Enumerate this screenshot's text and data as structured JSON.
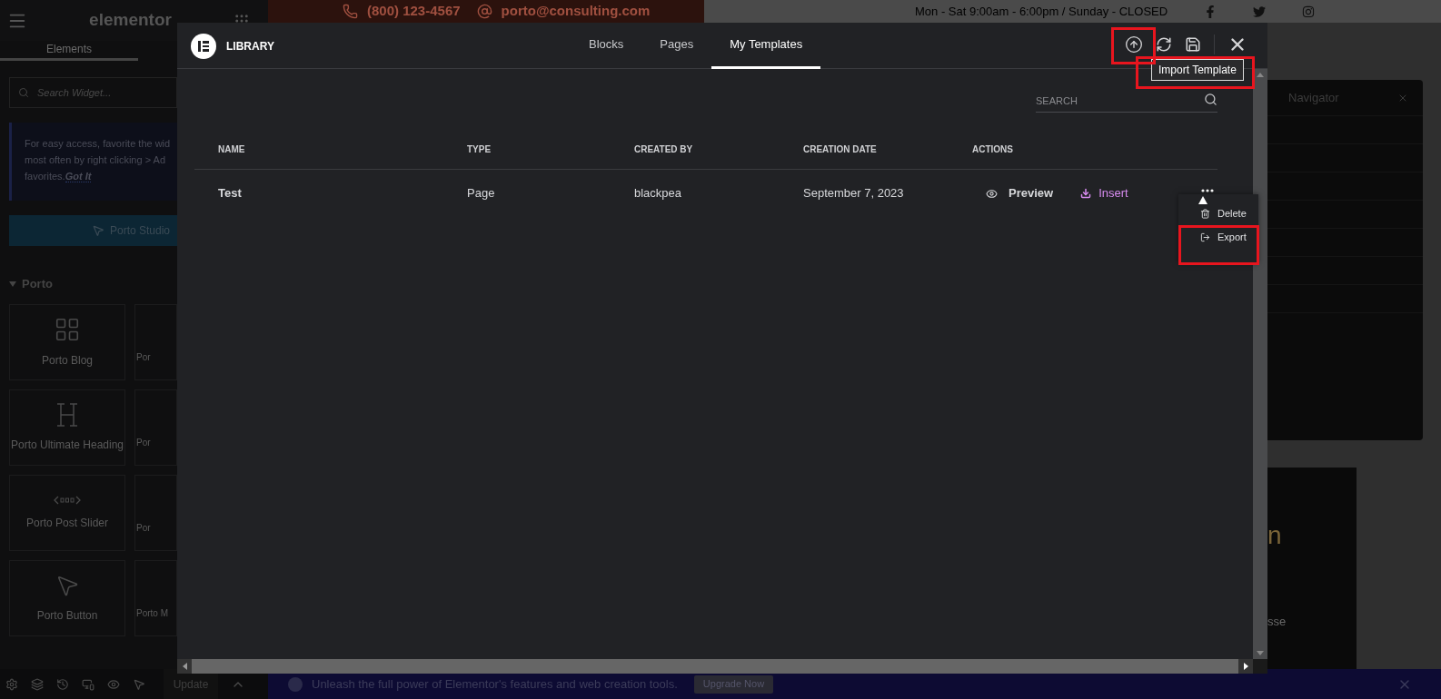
{
  "editor": {
    "brand": "elementor",
    "tabs": [
      {
        "label": "Elements",
        "selected": true
      }
    ],
    "search": {
      "placeholder": "Search Widget..."
    },
    "tip": {
      "lines": [
        "For easy access, favorite the wid",
        "most often by right clicking > Ad",
        "favorites."
      ],
      "link": "Got It"
    },
    "studio_button": "Porto Studio",
    "category": {
      "label": "Porto",
      "expanded": true
    },
    "widgets": [
      {
        "label": "Porto Blog",
        "kind": "blog"
      },
      {
        "label": "Por",
        "kind": "cut"
      },
      {
        "label": "Porto Ultimate Heading",
        "kind": "heading"
      },
      {
        "label": "Por",
        "kind": "cut"
      },
      {
        "label": "Porto Post Slider",
        "kind": "slider"
      },
      {
        "label": "Por",
        "kind": "cut"
      },
      {
        "label": "Porto Button",
        "kind": "button"
      },
      {
        "label": "Porto M",
        "kind": "cut"
      }
    ],
    "update_button": "Update"
  },
  "page": {
    "phone": "(800) 123-4567",
    "email": "porto@consulting.com",
    "hours": "Mon - Sat 9:00am - 6:00pm / Sunday - CLOSED",
    "navigator": {
      "title": "Navigator"
    },
    "fragments": [
      "n",
      "sse"
    ]
  },
  "library": {
    "title": "LIBRARY",
    "tabs": [
      {
        "label": "Blocks",
        "selected": false
      },
      {
        "label": "Pages",
        "selected": false
      },
      {
        "label": "My Templates",
        "selected": true
      }
    ],
    "tooltip": "Import Template",
    "search": {
      "placeholder": "SEARCH"
    },
    "columns": [
      "NAME",
      "TYPE",
      "CREATED BY",
      "CREATION DATE",
      "ACTIONS"
    ],
    "rows": [
      {
        "name": "Test",
        "type": "Page",
        "created_by": "blackpea",
        "date": "September 7, 2023",
        "preview": "Preview",
        "insert": "Insert"
      }
    ],
    "menu": [
      {
        "label": "Delete",
        "kind": "delete"
      },
      {
        "label": "Export",
        "kind": "export"
      }
    ]
  },
  "promo": {
    "text": "Unleash the full power of Elementor's features and web creation tools.",
    "button": "Upgrade Now"
  }
}
